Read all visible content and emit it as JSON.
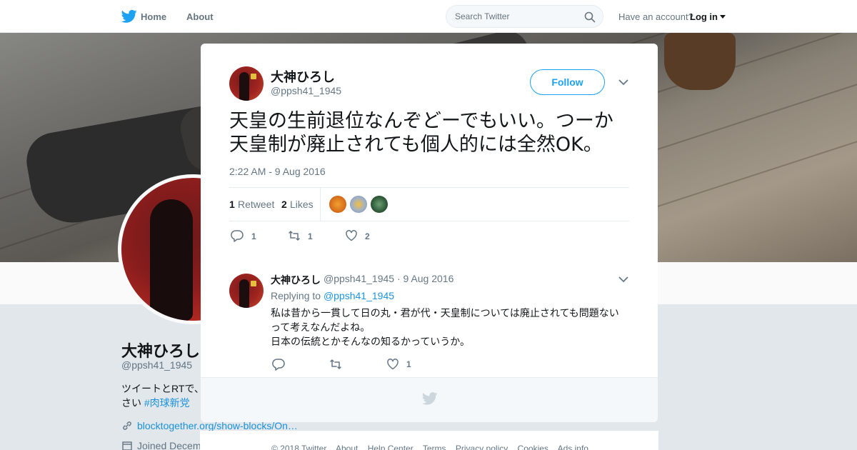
{
  "nav": {
    "home_label": "Home",
    "about_label": "About",
    "search_placeholder": "Search Twitter",
    "have_account": "Have an account?",
    "login_label": "Log in"
  },
  "background_profile": {
    "name": "大神ひろし",
    "handle": "@ppsh41_1945",
    "bio_visible": "ツイートとRTで、",
    "bio_line2": "さい",
    "hashtag": "#肉球新党",
    "link": "blocktogether.org/show-blocks/On…",
    "joined": "Joined Decem"
  },
  "tweet": {
    "author_name": "大神ひろし",
    "author_handle": "@ppsh41_1945",
    "follow_label": "Follow",
    "text_line1": "天皇の生前退位なんぞどーでもいい。つーか",
    "text_line2": "天皇制が廃止されても個人的には全然OK。",
    "timestamp": "2:22 AM - 9 Aug 2016",
    "retweet_count": "1",
    "retweet_label": "Retweet",
    "like_count": "2",
    "like_label": "Likes",
    "reply_action_count": "1",
    "retweet_action_count": "1",
    "like_action_count": "2"
  },
  "reply": {
    "author_name": "大神ひろし",
    "meta": "@ppsh41_1945 · 9 Aug 2016",
    "replying_prefix": "Replying to",
    "replying_to": "@ppsh41_1945",
    "text_line1": "私は昔から一貫して日の丸・君が代・天皇制については廃止されても問題ない",
    "text_line2": "って考えなんだよね。",
    "text_line3": "日本の伝統とかそんなの知るかっていうか。",
    "like_action_count": "1"
  },
  "footer": {
    "copyright": "© 2018 Twitter",
    "links": [
      "About",
      "Help Center",
      "Terms",
      "Privacy policy",
      "Cookies",
      "Ads info"
    ]
  },
  "colors": {
    "accent": "#1da1f2",
    "link": "#1b95e0",
    "muted": "#657786"
  }
}
